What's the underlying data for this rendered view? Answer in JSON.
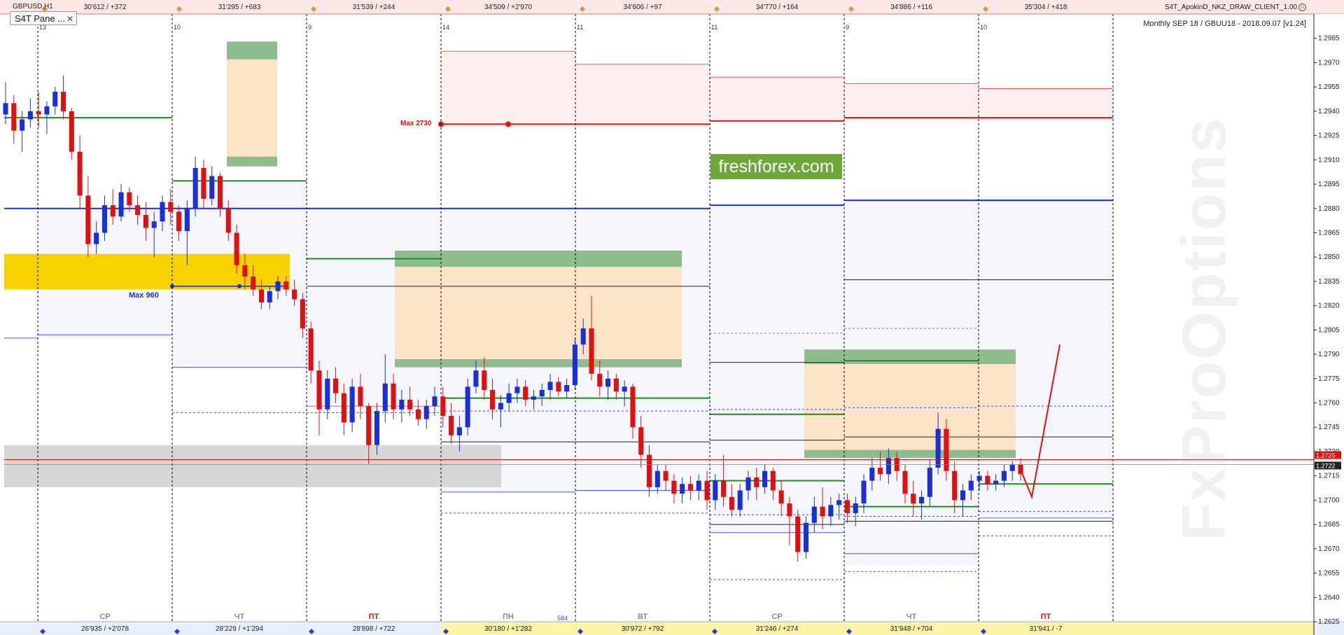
{
  "header": {
    "symbol": "GBPUSD,H1",
    "ea_title": "S4T_ApokinD_NKZ_DRAW_CLIENT_1.00",
    "ea_icon": "☺",
    "info": "Monthly SEP 18 / GBUU18 - 2018.09.07 [v1.24]"
  },
  "panel_button": {
    "label": "S4T Pane ...",
    "close": "✕"
  },
  "brand": {
    "text": "freshforex.com",
    "color": "#6fa83a"
  },
  "watermark": {
    "text": "FxProOptions"
  },
  "annotations": {
    "max960": "Max 960",
    "max2730": "Max 2730",
    "vol584": "584"
  },
  "top_bar": [
    {
      "label": "30'612 / +372",
      "day": "13"
    },
    {
      "label": "31'295 / +683",
      "day": "10"
    },
    {
      "label": "31'539 / +244",
      "day": "9"
    },
    {
      "label": "34'509 / +2'970",
      "day": "14"
    },
    {
      "label": "34'606 / +97",
      "day": "11"
    },
    {
      "label": "34'770 / +164",
      "day": "11"
    },
    {
      "label": "34'886 / +116",
      "day": "9"
    },
    {
      "label": "35'304 / +418",
      "day": "10"
    }
  ],
  "bottom_bar": [
    {
      "label": "26'935 / +2'078",
      "weekday": "СР"
    },
    {
      "label": "28'229 / +1'294",
      "weekday": "ЧТ"
    },
    {
      "label": "28'898 / +722",
      "weekday": "ПТ"
    },
    {
      "label": "30'180 / +1'282",
      "weekday": "ПН"
    },
    {
      "label": "30'972 / +792",
      "weekday": "ВТ"
    },
    {
      "label": "31'246 / +274",
      "weekday": "СР"
    },
    {
      "label": "31'948 / +704",
      "weekday": "ЧТ"
    },
    {
      "label": "31'941 / -7",
      "weekday": "ПТ"
    }
  ],
  "price_axis": {
    "labels": [
      "1.2985",
      "1.2970",
      "1.2955",
      "1.2940",
      "1.2925",
      "1.2910",
      "1.2895",
      "1.2880",
      "1.2865",
      "1.2850",
      "1.2835",
      "1.2820",
      "1.2805",
      "1.2790",
      "1.2775",
      "1.2760",
      "1.2745",
      "1.2730",
      "1.2715",
      "1.2700",
      "1.2685",
      "1.2670",
      "1.2655",
      "1.2640",
      "1.2625"
    ],
    "current_price": "1.2722",
    "current_price_alt": "1.2725"
  },
  "chart_data": {
    "type": "candlestick",
    "ylim": [
      1.2625,
      1.3
    ],
    "colors": {
      "bull": "#1a2fd6",
      "bear": "#e01010",
      "grid": "#000000"
    },
    "candles": [
      [
        1.2938,
        1.2958,
        1.2932,
        1.2945
      ],
      [
        1.2945,
        1.295,
        1.292,
        1.2928
      ],
      [
        1.2928,
        1.294,
        1.2915,
        1.2935
      ],
      [
        1.2935,
        1.2948,
        1.293,
        1.294
      ],
      [
        1.294,
        1.2952,
        1.293,
        1.2938
      ],
      [
        1.2938,
        1.2946,
        1.2926,
        1.2943
      ],
      [
        1.2943,
        1.2955,
        1.2938,
        1.2952
      ],
      [
        1.2952,
        1.2962,
        1.2935,
        1.294
      ],
      [
        1.294,
        1.2942,
        1.291,
        1.2915
      ],
      [
        1.2915,
        1.2925,
        1.288,
        1.2888
      ],
      [
        1.2888,
        1.29,
        1.285,
        1.2858
      ],
      [
        1.2858,
        1.2872,
        1.2852,
        1.2865
      ],
      [
        1.2865,
        1.2888,
        1.286,
        1.2882
      ],
      [
        1.2882,
        1.2892,
        1.287,
        1.2875
      ],
      [
        1.2875,
        1.2895,
        1.2872,
        1.289
      ],
      [
        1.289,
        1.2893,
        1.2878,
        1.2882
      ],
      [
        1.2882,
        1.2888,
        1.287,
        1.2876
      ],
      [
        1.2876,
        1.2884,
        1.286,
        1.2868
      ],
      [
        1.2868,
        1.2878,
        1.285,
        1.2872
      ],
      [
        1.2872,
        1.2888,
        1.2866,
        1.2884
      ],
      [
        1.2884,
        1.2892,
        1.287,
        1.2878
      ],
      [
        1.2878,
        1.2882,
        1.286,
        1.2866
      ],
      [
        1.2866,
        1.2885,
        1.2845,
        1.288
      ],
      [
        1.288,
        1.2912,
        1.2875,
        1.2905
      ],
      [
        1.2905,
        1.291,
        1.288,
        1.2886
      ],
      [
        1.2886,
        1.2906,
        1.2882,
        1.29
      ],
      [
        1.29,
        1.2902,
        1.2875,
        1.288
      ],
      [
        1.288,
        1.2885,
        1.286,
        1.2865
      ],
      [
        1.2865,
        1.287,
        1.284,
        1.2845
      ],
      [
        1.2845,
        1.2852,
        1.283,
        1.2838
      ],
      [
        1.2838,
        1.2845,
        1.2826,
        1.283
      ],
      [
        1.283,
        1.2836,
        1.2818,
        1.2822
      ],
      [
        1.2822,
        1.2832,
        1.2818,
        1.2829
      ],
      [
        1.2829,
        1.2838,
        1.2824,
        1.2835
      ],
      [
        1.2835,
        1.2838,
        1.2826,
        1.283
      ],
      [
        1.283,
        1.2836,
        1.282,
        1.2824
      ],
      [
        1.2824,
        1.2828,
        1.28,
        1.2806
      ],
      [
        1.2806,
        1.281,
        1.2772,
        1.278
      ],
      [
        1.278,
        1.2786,
        1.274,
        1.2756
      ],
      [
        1.2756,
        1.278,
        1.275,
        1.2775
      ],
      [
        1.2775,
        1.2782,
        1.276,
        1.2766
      ],
      [
        1.2766,
        1.2772,
        1.274,
        1.2748
      ],
      [
        1.2748,
        1.2775,
        1.2742,
        1.277
      ],
      [
        1.277,
        1.2778,
        1.275,
        1.2758
      ],
      [
        1.2758,
        1.276,
        1.2722,
        1.2734
      ],
      [
        1.2734,
        1.276,
        1.2728,
        1.2755
      ],
      [
        1.2755,
        1.279,
        1.2748,
        1.2772
      ],
      [
        1.2772,
        1.2778,
        1.275,
        1.2756
      ],
      [
        1.2756,
        1.2768,
        1.2748,
        1.2762
      ],
      [
        1.2762,
        1.277,
        1.2752,
        1.2756
      ],
      [
        1.2756,
        1.2762,
        1.2746,
        1.275
      ],
      [
        1.275,
        1.2762,
        1.2744,
        1.2758
      ],
      [
        1.2758,
        1.277,
        1.2752,
        1.2764
      ],
      [
        1.2764,
        1.277,
        1.2745,
        1.2752
      ],
      [
        1.2752,
        1.276,
        1.2735,
        1.274
      ],
      [
        1.274,
        1.2752,
        1.273,
        1.2745
      ],
      [
        1.2745,
        1.2775,
        1.274,
        1.277
      ],
      [
        1.277,
        1.2786,
        1.2766,
        1.278
      ],
      [
        1.278,
        1.2788,
        1.2762,
        1.2768
      ],
      [
        1.2768,
        1.2775,
        1.275,
        1.2756
      ],
      [
        1.2756,
        1.2765,
        1.2745,
        1.276
      ],
      [
        1.276,
        1.2772,
        1.2755,
        1.2766
      ],
      [
        1.2766,
        1.2775,
        1.276,
        1.277
      ],
      [
        1.277,
        1.2774,
        1.2758,
        1.2762
      ],
      [
        1.2762,
        1.2768,
        1.2756,
        1.2764
      ],
      [
        1.2764,
        1.2772,
        1.2758,
        1.2768
      ],
      [
        1.2768,
        1.2778,
        1.2762,
        1.2773
      ],
      [
        1.2773,
        1.2776,
        1.2764,
        1.2767
      ],
      [
        1.2767,
        1.2775,
        1.2763,
        1.2771
      ],
      [
        1.2771,
        1.28,
        1.2768,
        1.2796
      ],
      [
        1.2796,
        1.2812,
        1.279,
        1.2806
      ],
      [
        1.2806,
        1.2826,
        1.2774,
        1.2778
      ],
      [
        1.2778,
        1.2786,
        1.2764,
        1.277
      ],
      [
        1.277,
        1.278,
        1.2762,
        1.2775
      ],
      [
        1.2775,
        1.2778,
        1.2762,
        1.2767
      ],
      [
        1.2767,
        1.2774,
        1.2758,
        1.277
      ],
      [
        1.277,
        1.2772,
        1.2738,
        1.2745
      ],
      [
        1.2745,
        1.2752,
        1.272,
        1.2728
      ],
      [
        1.2728,
        1.2734,
        1.2702,
        1.2708
      ],
      [
        1.2708,
        1.2722,
        1.2704,
        1.2718
      ],
      [
        1.2718,
        1.2722,
        1.2706,
        1.2712
      ],
      [
        1.2712,
        1.2716,
        1.2698,
        1.2704
      ],
      [
        1.2704,
        1.2714,
        1.2698,
        1.271
      ],
      [
        1.271,
        1.2715,
        1.27,
        1.2706
      ],
      [
        1.2706,
        1.2716,
        1.27,
        1.2712
      ],
      [
        1.2712,
        1.2718,
        1.2694,
        1.27
      ],
      [
        1.27,
        1.2716,
        1.2694,
        1.2712
      ],
      [
        1.2712,
        1.2728,
        1.2696,
        1.2702
      ],
      [
        1.2702,
        1.271,
        1.269,
        1.2694
      ],
      [
        1.2694,
        1.271,
        1.269,
        1.2706
      ],
      [
        1.2706,
        1.2718,
        1.27,
        1.2714
      ],
      [
        1.2714,
        1.272,
        1.27,
        1.2708
      ],
      [
        1.2708,
        1.2722,
        1.2704,
        1.2718
      ],
      [
        1.2718,
        1.272,
        1.27,
        1.2706
      ],
      [
        1.2706,
        1.2712,
        1.269,
        1.2698
      ],
      [
        1.2698,
        1.2702,
        1.2672,
        1.269
      ],
      [
        1.269,
        1.2694,
        1.2662,
        1.2668
      ],
      [
        1.2668,
        1.269,
        1.2664,
        1.2686
      ],
      [
        1.2686,
        1.2702,
        1.268,
        1.2696
      ],
      [
        1.2696,
        1.2708,
        1.2682,
        1.269
      ],
      [
        1.269,
        1.2702,
        1.2684,
        1.2697
      ],
      [
        1.2697,
        1.2704,
        1.2688,
        1.27
      ],
      [
        1.27,
        1.2704,
        1.2686,
        1.2692
      ],
      [
        1.2692,
        1.2702,
        1.2684,
        1.2698
      ],
      [
        1.2698,
        1.2716,
        1.2692,
        1.2712
      ],
      [
        1.2712,
        1.2726,
        1.2706,
        1.272
      ],
      [
        1.272,
        1.273,
        1.2712,
        1.2716
      ],
      [
        1.2716,
        1.2732,
        1.271,
        1.2726
      ],
      [
        1.2726,
        1.273,
        1.2712,
        1.2718
      ],
      [
        1.2718,
        1.2722,
        1.2698,
        1.2704
      ],
      [
        1.2704,
        1.2712,
        1.269,
        1.2698
      ],
      [
        1.2698,
        1.2706,
        1.2688,
        1.2702
      ],
      [
        1.2702,
        1.2725,
        1.2696,
        1.272
      ],
      [
        1.272,
        1.2754,
        1.2716,
        1.2744
      ],
      [
        1.2744,
        1.275,
        1.2712,
        1.2718
      ],
      [
        1.2718,
        1.2724,
        1.2692,
        1.27
      ],
      [
        1.27,
        1.271,
        1.269,
        1.2706
      ],
      [
        1.2706,
        1.2716,
        1.27,
        1.2712
      ],
      [
        1.2712,
        1.2718,
        1.2706,
        1.2715
      ],
      [
        1.2715,
        1.2718,
        1.2706,
        1.271
      ],
      [
        1.271,
        1.2716,
        1.2706,
        1.2712
      ],
      [
        1.2712,
        1.2722,
        1.2708,
        1.2718
      ],
      [
        1.2718,
        1.2724,
        1.2712,
        1.2722
      ],
      [
        1.2722,
        1.2726,
        1.2712,
        1.2716
      ]
    ]
  }
}
